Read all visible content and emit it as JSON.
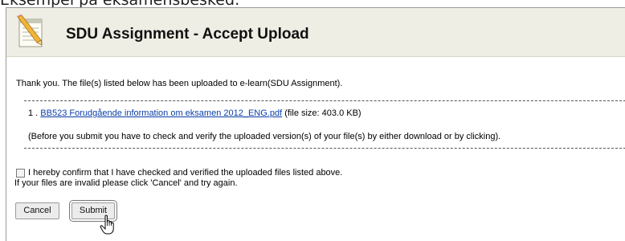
{
  "caption": "Eksempel på eksamensbesked:",
  "header": {
    "title": "SDU Assignment - Accept Upload"
  },
  "content": {
    "intro": "Thank you. The file(s) listed below has been uploaded to e-learn(SDU Assignment).",
    "file": {
      "index": "1 . ",
      "name": "BB523 Forudgående information om eksamen 2012_ENG.pdf",
      "size": " (file size: 403.0 KB)"
    },
    "verify_note": "(Before you submit you have to check and verify the uploaded version(s) of your file(s) by either download or by clicking).",
    "confirm_label": "I hereby confirm that I have checked and verified the uploaded files listed above.",
    "confirm_checked": false,
    "invalid_note": "If your files are invalid please click 'Cancel' and try again."
  },
  "buttons": {
    "cancel": "Cancel",
    "submit": "Submit"
  },
  "icons": {
    "header": "notepad-pencil-icon",
    "cursor": "hand-pointer-icon"
  },
  "colors": {
    "header_bg": "#efeee4",
    "link": "#0a3ea8"
  }
}
